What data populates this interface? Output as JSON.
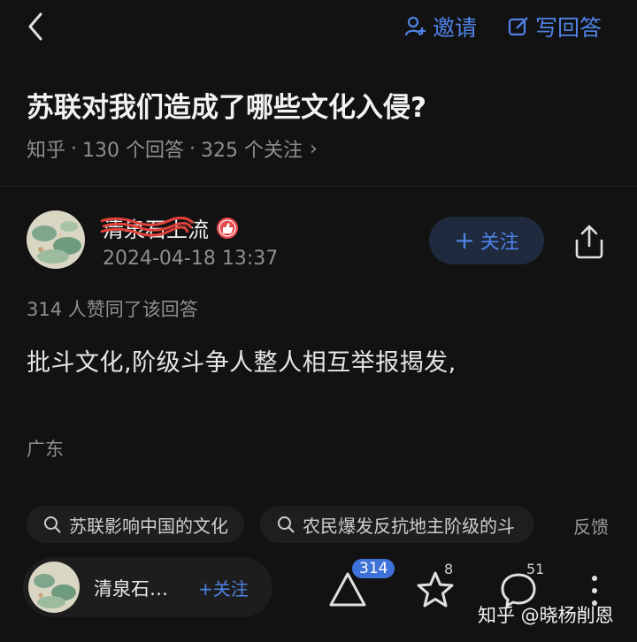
{
  "header": {
    "invite_label": "邀请",
    "write_answer_label": "写回答"
  },
  "question": {
    "title": "苏联对我们造成了哪些文化入侵?",
    "source": "知乎",
    "answers_count": "130 个回答",
    "followers_count": "325 个关注",
    "sep": "·"
  },
  "answer": {
    "author_name": "清泉石上流",
    "time": "2024-04-18 13:37",
    "follow_label": "关注",
    "votes_text": "314 人赞同了该回答",
    "body": "批斗文化,阶级斗争人整人相互举报揭发,",
    "location": "广东"
  },
  "chips": [
    {
      "label": "苏联影响中国的文化"
    },
    {
      "label": "农民爆发反抗地主阶级的斗"
    }
  ],
  "feedback_label": "反馈",
  "bottom_bar": {
    "author_short": "清泉石…",
    "follow_label": "+关注",
    "upvote_count": "314",
    "star_count": "8",
    "comment_count": "51"
  },
  "watermark": "知乎 @晓杨削恩",
  "colors": {
    "accent": "#4f83e6",
    "background": "#121212"
  }
}
